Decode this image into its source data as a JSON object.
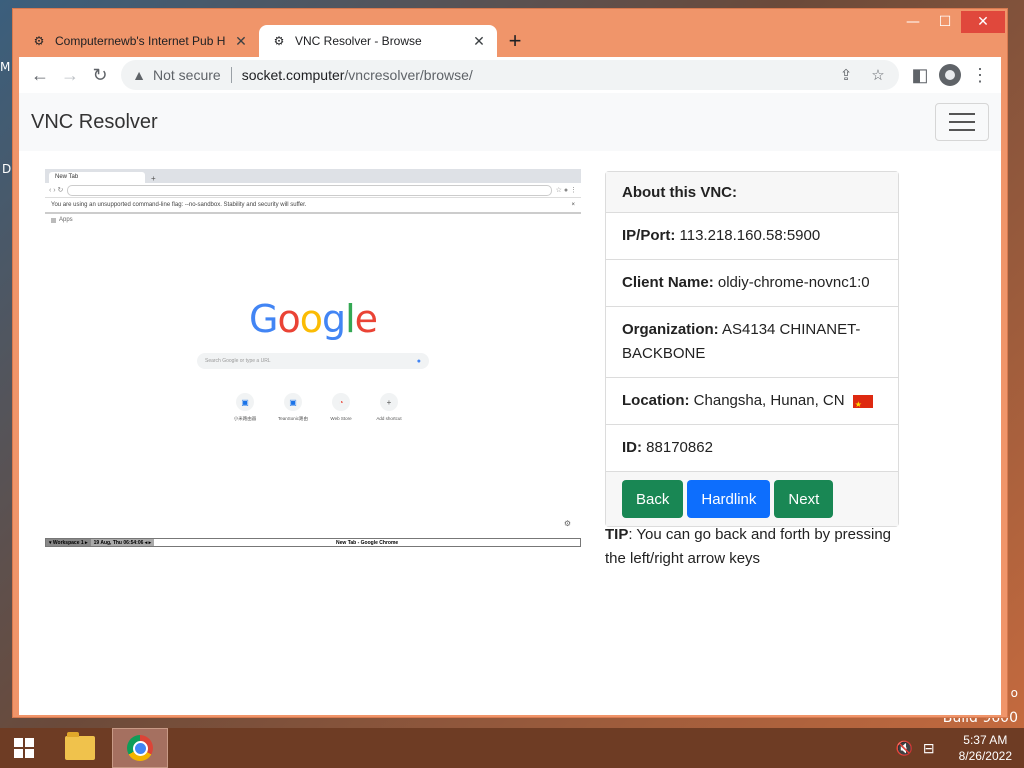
{
  "desktop": {
    "fragment_top": "M",
    "fragment_mid": "D",
    "fragment_right": "o",
    "build_text": "Build 9600"
  },
  "window": {
    "minimize_glyph": "—",
    "maximize_glyph": "☐",
    "close_glyph": "✕"
  },
  "tabs": [
    {
      "title": "Computernewb's Internet Pub H",
      "close": "✕"
    },
    {
      "title": "VNC Resolver - Browse",
      "close": "✕"
    }
  ],
  "new_tab_glyph": "+",
  "toolbar": {
    "security_label": "Not secure",
    "url_host": "socket.computer",
    "url_path": "/vncresolver/browse/"
  },
  "page": {
    "brand": "VNC Resolver",
    "preview": {
      "tab_label": "New Tab",
      "tab_plus": "+",
      "info_bar": "You are using an unsupported command-line flag: --no-sandbox. Stability and security will suffer.",
      "info_close": "×",
      "apps_label": "Apps",
      "search_placeholder": "Search Google or type a URL",
      "shortcuts": [
        {
          "label": "小米路由器"
        },
        {
          "label": "TeanSonic路由"
        },
        {
          "label": "Web Store"
        },
        {
          "label": "Add shortcut"
        }
      ],
      "workspace": "▾ Workspace 1 ▸",
      "clock": "19 Aug, Thu 06:54:06 ◂ ▸",
      "window_title": "New Tab - Google Chrome"
    },
    "card": {
      "header": "About this VNC:",
      "ip_label": "IP/Port:",
      "ip_value": "113.218.160.58:5900",
      "client_label": "Client Name:",
      "client_value": "oldiy-chrome-novnc1:0",
      "org_label": "Organization:",
      "org_value": "AS4134 CHINANET-BACKBONE",
      "loc_label": "Location:",
      "loc_value": "Changsha, Hunan, CN",
      "id_label": "ID:",
      "id_value": "88170862",
      "buttons": {
        "back": "Back",
        "hardlink": "Hardlink",
        "next": "Next"
      }
    },
    "tip_label": "TIP",
    "tip_text": ": You can go back and forth by pressing the left/right arrow keys"
  },
  "taskbar": {
    "time": "5:37 AM",
    "date": "8/26/2022"
  },
  "colors": {
    "window_frame": "#f0956a",
    "btn_green": "#198754",
    "btn_blue": "#0d6efd",
    "taskbar": "#6e3c24"
  }
}
